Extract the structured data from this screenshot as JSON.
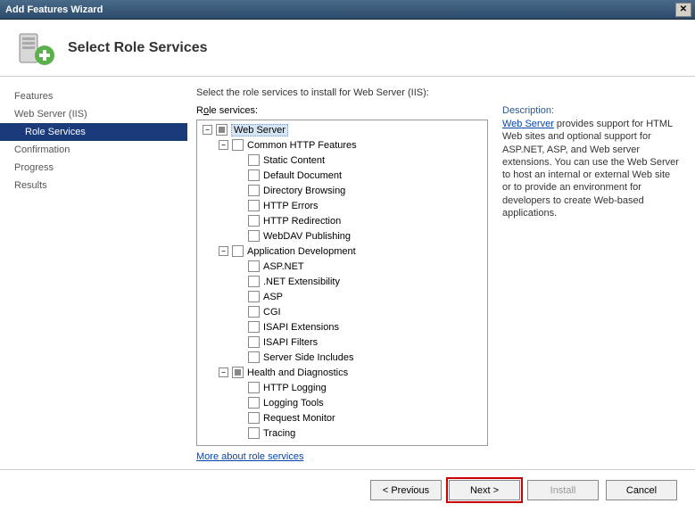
{
  "window": {
    "title": "Add Features Wizard"
  },
  "header": {
    "title": "Select Role Services"
  },
  "sidebar": {
    "steps": [
      {
        "label": "Features",
        "indent": 0,
        "selected": false
      },
      {
        "label": "Web Server (IIS)",
        "indent": 0,
        "selected": false
      },
      {
        "label": "Role Services",
        "indent": 1,
        "selected": true
      },
      {
        "label": "Confirmation",
        "indent": 0,
        "selected": false
      },
      {
        "label": "Progress",
        "indent": 0,
        "selected": false
      },
      {
        "label": "Results",
        "indent": 0,
        "selected": false
      }
    ]
  },
  "main": {
    "instruction": "Select the role services to install for Web Server (IIS):",
    "tree_label_pre": "R",
    "tree_label_u": "o",
    "tree_label_post": "le services:",
    "more_link": "More about role services"
  },
  "tree": [
    {
      "level": 0,
      "toggle": "-",
      "check": "partial",
      "label": "Web Server",
      "selected": true
    },
    {
      "level": 1,
      "toggle": "-",
      "check": "empty",
      "label": "Common HTTP Features"
    },
    {
      "level": 2,
      "toggle": "",
      "check": "empty",
      "label": "Static Content"
    },
    {
      "level": 2,
      "toggle": "",
      "check": "empty",
      "label": "Default Document"
    },
    {
      "level": 2,
      "toggle": "",
      "check": "empty",
      "label": "Directory Browsing"
    },
    {
      "level": 2,
      "toggle": "",
      "check": "empty",
      "label": "HTTP Errors"
    },
    {
      "level": 2,
      "toggle": "",
      "check": "empty",
      "label": "HTTP Redirection"
    },
    {
      "level": 2,
      "toggle": "",
      "check": "empty",
      "label": "WebDAV Publishing"
    },
    {
      "level": 1,
      "toggle": "-",
      "check": "empty",
      "label": "Application Development"
    },
    {
      "level": 2,
      "toggle": "",
      "check": "empty",
      "label": "ASP.NET"
    },
    {
      "level": 2,
      "toggle": "",
      "check": "empty",
      "label": ".NET Extensibility"
    },
    {
      "level": 2,
      "toggle": "",
      "check": "empty",
      "label": "ASP"
    },
    {
      "level": 2,
      "toggle": "",
      "check": "empty",
      "label": "CGI"
    },
    {
      "level": 2,
      "toggle": "",
      "check": "empty",
      "label": "ISAPI Extensions"
    },
    {
      "level": 2,
      "toggle": "",
      "check": "empty",
      "label": "ISAPI Filters"
    },
    {
      "level": 2,
      "toggle": "",
      "check": "empty",
      "label": "Server Side Includes"
    },
    {
      "level": 1,
      "toggle": "-",
      "check": "partial",
      "label": "Health and Diagnostics"
    },
    {
      "level": 2,
      "toggle": "",
      "check": "empty",
      "label": "HTTP Logging"
    },
    {
      "level": 2,
      "toggle": "",
      "check": "empty",
      "label": "Logging Tools"
    },
    {
      "level": 2,
      "toggle": "",
      "check": "empty",
      "label": "Request Monitor"
    },
    {
      "level": 2,
      "toggle": "",
      "check": "empty",
      "label": "Tracing"
    }
  ],
  "description": {
    "title": "Description:",
    "link": "Web Server",
    "text": " provides support for HTML Web sites and optional support for ASP.NET, ASP, and Web server extensions. You can use the Web Server to host an internal or external Web site or to provide an environment for developers to create Web-based applications."
  },
  "footer": {
    "previous_pre": "< ",
    "previous_u": "P",
    "previous_post": "revious",
    "next_pre": "",
    "next_u": "N",
    "next_post": "ext >",
    "install_pre": "",
    "install_u": "I",
    "install_post": "nstall",
    "cancel": "Cancel"
  }
}
